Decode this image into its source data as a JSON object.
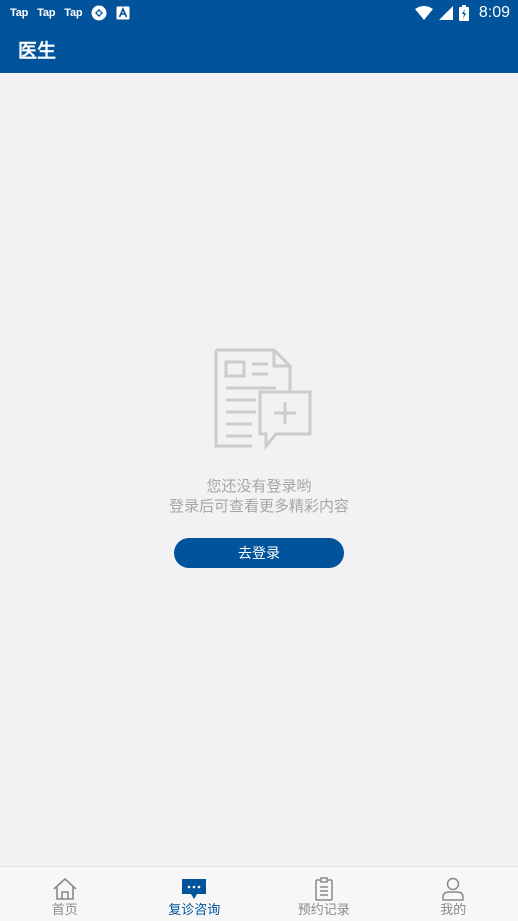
{
  "status_bar": {
    "apps": [
      "Tap",
      "Tap",
      "Tap"
    ],
    "time": "8:09"
  },
  "app_bar": {
    "title": "医生"
  },
  "empty_state": {
    "line1": "您还没有登录哟",
    "line2": "登录后可查看更多精彩内容",
    "button_label": "去登录"
  },
  "tab_bar": {
    "tabs": [
      {
        "label": "首页",
        "icon": "home-icon",
        "active": false
      },
      {
        "label": "复诊咨询",
        "icon": "chat-icon",
        "active": true
      },
      {
        "label": "预约记录",
        "icon": "clipboard-icon",
        "active": false
      },
      {
        "label": "我的",
        "icon": "user-icon",
        "active": false
      }
    ]
  },
  "colors": {
    "primary": "#01539b",
    "background": "#f2f2f4",
    "muted_text": "#a6a6a6",
    "inactive_tab": "#8a8a8a"
  }
}
